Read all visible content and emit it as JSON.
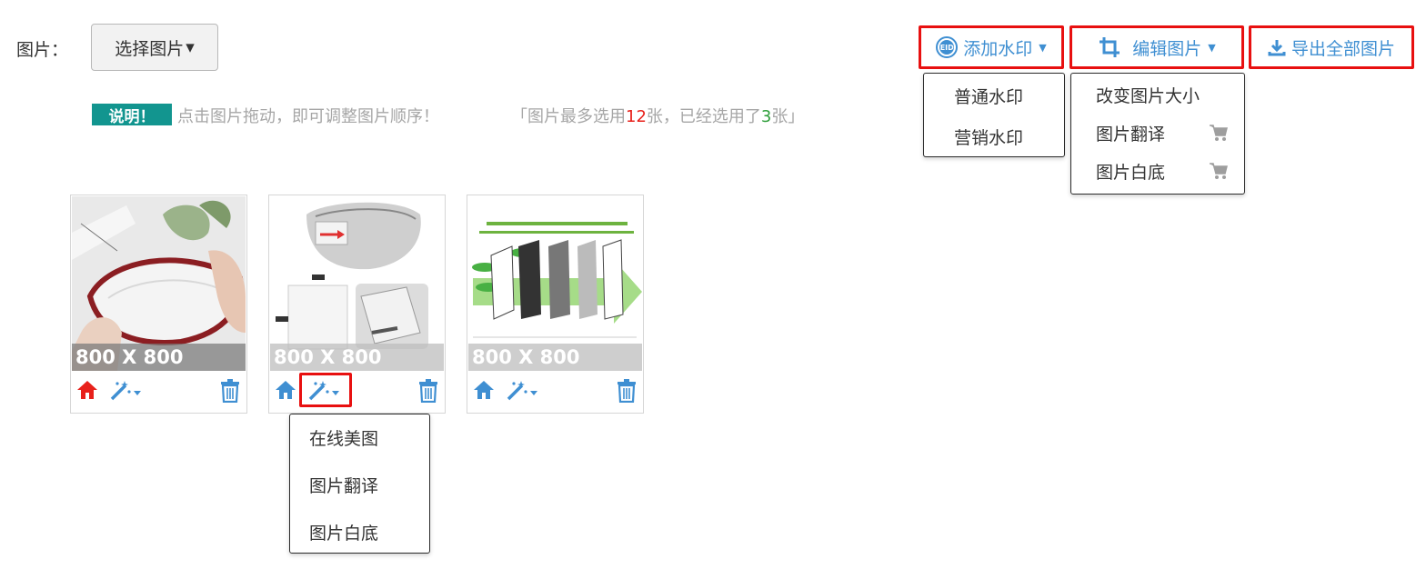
{
  "field_label": "图片：",
  "select_button": {
    "label": "选择图片",
    "caret": "▾"
  },
  "notice": {
    "badge": "说明！",
    "text": "点击图片拖动，即可调整图片顺序！",
    "count_prefix": "「图片最多选用",
    "max": "12",
    "count_mid": "张，已经选用了",
    "used": "3",
    "count_suffix": "张」"
  },
  "toolbar": {
    "watermark_label": "添加水印",
    "watermark_icon_text": "EID",
    "edit_label": "编辑图片",
    "export_label": "导出全部图片"
  },
  "watermark_menu": [
    "普通水印",
    "营销水印"
  ],
  "edit_menu": {
    "items": [
      "改变图片大小",
      "图片翻译",
      "图片白底"
    ],
    "paid": [
      false,
      true,
      true
    ]
  },
  "images": [
    {
      "size": "800 X 800",
      "home_active": true
    },
    {
      "size": "800 X 800",
      "home_active": false
    },
    {
      "size": "800 X 800",
      "home_active": false
    }
  ],
  "image_menu": [
    "在线美图",
    "图片翻译",
    "图片白底"
  ],
  "colors": {
    "accent": "#3f8fd2",
    "highlight": "#e81010",
    "badge": "#12958f",
    "home_active": "#e8211b",
    "home": "#3f8fd2"
  }
}
